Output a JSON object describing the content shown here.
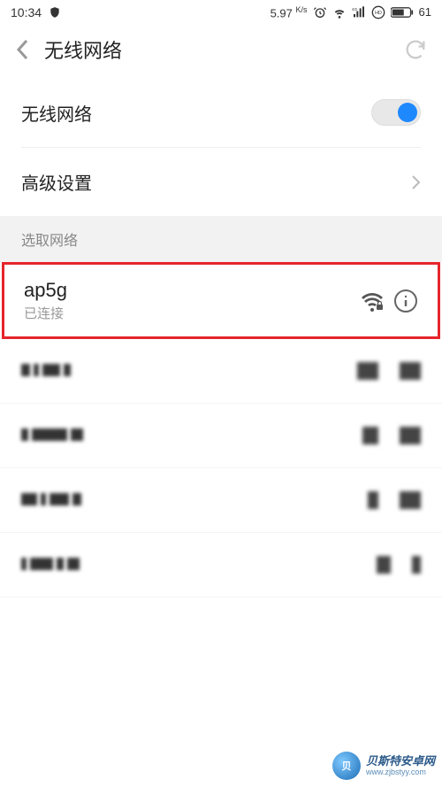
{
  "status_bar": {
    "time": "10:34",
    "speed": "5.97",
    "speed_unit": "K/s",
    "hd_label": "HD",
    "battery": "61"
  },
  "header": {
    "title": "无线网络"
  },
  "settings": {
    "wifi_label": "无线网络",
    "wifi_enabled": true,
    "advanced_label": "高级设置"
  },
  "list_header": "选取网络",
  "networks": [
    {
      "name": "ap5g",
      "status": "已连接",
      "highlighted": true,
      "secured": true
    }
  ],
  "blurred_count": 4,
  "watermark": {
    "line1": "贝斯特安卓网",
    "line2": "www.zjbstyy.com"
  }
}
